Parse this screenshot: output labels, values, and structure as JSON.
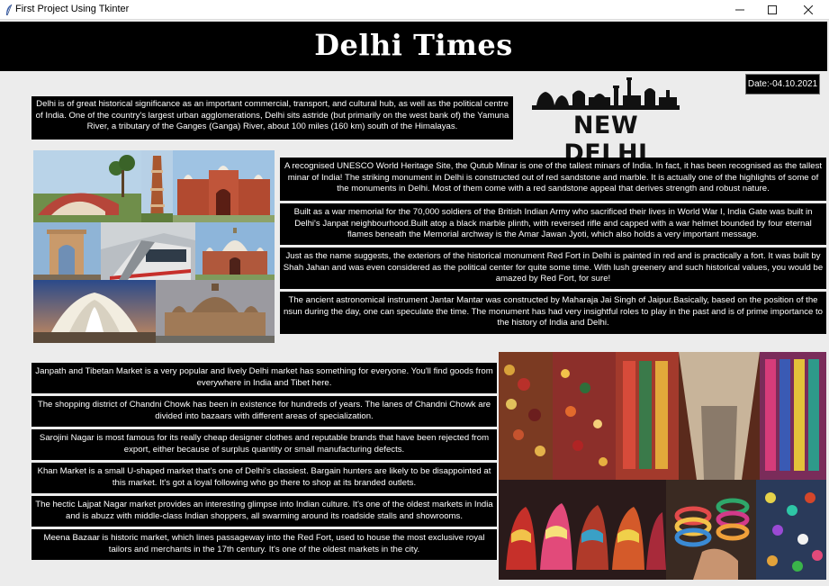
{
  "window": {
    "title": "First Project Using Tkinter",
    "minimize_icon": "minimize-icon",
    "maximize_icon": "maximize-icon",
    "close_icon": "close-icon",
    "app_icon": "feather-icon"
  },
  "header": {
    "name": "Delhi Times",
    "date": "Date:-04.10.2021"
  },
  "intro": "Delhi is of great historical significance as an important commercial, transport, and cultural hub, as well as the political centre of India. One of the country's largest urban agglomerations, Delhi sits astride (but primarily on the west bank of) the Yamuna River, a tributary of the Ganges (Ganga) River, about 100 miles (160 km) south of the Himalayas.",
  "logo": {
    "text": "NEW DELHI",
    "icon": "delhi-skyline-icon"
  },
  "monuments": [
    "A recognised UNESCO World Heritage Site, the Qutub Minar is one of the tallest minars of India. In fact, it has been recognised as the tallest minar of India! The striking monument in Delhi is constructed out of red sandstone and marble. It is actually one of the highlights of some of the monuments in Delhi. Most of them come with a red sandstone appeal that derives strength and robust nature.",
    "Built as a war memorial for the 70,000 soldiers of the British Indian Army who sacrificed their lives in World War I, India Gate was built in Delhi's Janpat neighbourhood.Built atop a black marble plinth, with reversed rifle and capped with a war helmet bounded by four eternal flames beneath the Memorial archway is the Amar Jawan Jyoti, which also holds a very important message.",
    "Just as the name suggests, the exteriors of the historical monument Red Fort in Delhi is painted in red and is practically a fort. It was built by Shah Jahan and was even considered as the political center for quite some time. With lush greenery and such historical values, you would be amazed by Red Fort, for sure!",
    "The ancient astronomical instrument Jantar Mantar was constructed by Maharaja Jai Singh of Jaipur.Basically, based on the position of the nsun during the day, one can speculate the time. The monument has had very insightful roles to play in the past and is of prime importance to the history of India and Delhi."
  ],
  "markets": [
    "Janpath and Tibetan Market is a very popular and lively Delhi market has something for everyone. You'll find goods from everywhere in India and Tibet here.",
    "The shopping district of Chandni Chowk has been in existence for hundreds of years. The lanes of Chandni Chowk are divided into bazaars with different areas of specialization.",
    "Sarojini Nagar is most famous for its really cheap designer clothes and reputable brands that have been rejected from export, either because of surplus quantity or small manufacturing defects.",
    "Khan Market is a small U-shaped market that's one of Delhi's classiest. Bargain hunters are likely to be disappointed at this market. It's got a loyal following who go there to shop at its branded outlets.",
    "The hectic Lajpat Nagar market provides an interesting glimpse into Indian culture. It's one of the oldest markets in India and is abuzz with middle-class Indian shoppers, all swarming around its roadside stalls and showrooms.",
    "Meena Bazaar is historic market, which lines passageway into the Red Fort, used to house the most exclusive royal tailors and merchants in the 17th century. It's one of the oldest markets in the city."
  ]
}
